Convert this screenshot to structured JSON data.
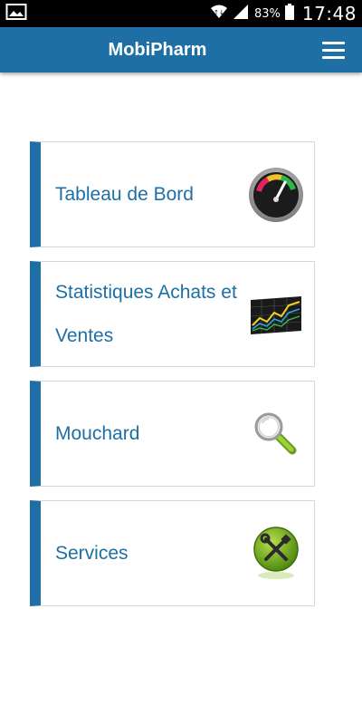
{
  "status_bar": {
    "battery_percent": "83%",
    "time": "17:48",
    "icons": [
      "image-notification-icon",
      "wifi-icon",
      "signal-icon",
      "battery-icon"
    ]
  },
  "app_bar": {
    "title": "MobiPharm",
    "menu_icon": "hamburger-menu-icon",
    "color": "#1d6fa5"
  },
  "menu": {
    "items": [
      {
        "label": "Tableau de Bord",
        "icon": "dashboard-gauge-icon"
      },
      {
        "label": "Statistiques Achats et Ventes",
        "icon": "stock-chart-icon"
      },
      {
        "label": "Mouchard",
        "icon": "magnifier-icon"
      },
      {
        "label": "Services",
        "icon": "tools-icon"
      }
    ]
  }
}
